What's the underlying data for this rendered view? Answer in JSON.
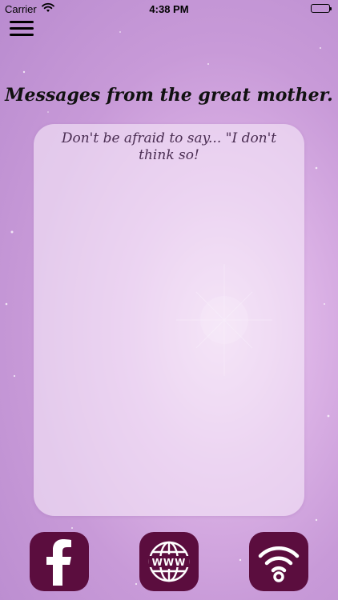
{
  "status_bar": {
    "carrier": "Carrier",
    "time": "4:38 PM"
  },
  "header": {
    "menu_icon": "hamburger-menu-icon",
    "title": "Messages from the great mother."
  },
  "card": {
    "message": "Don't be afraid to say... \"I don't think so!"
  },
  "bottom_bar": {
    "buttons": [
      {
        "icon": "facebook-icon"
      },
      {
        "icon": "globe-www-icon"
      },
      {
        "icon": "wifi-signal-icon"
      }
    ]
  },
  "colors": {
    "button_bg": "#5b0d3e",
    "text_dark": "#111111",
    "message_text": "#4a2d52"
  }
}
